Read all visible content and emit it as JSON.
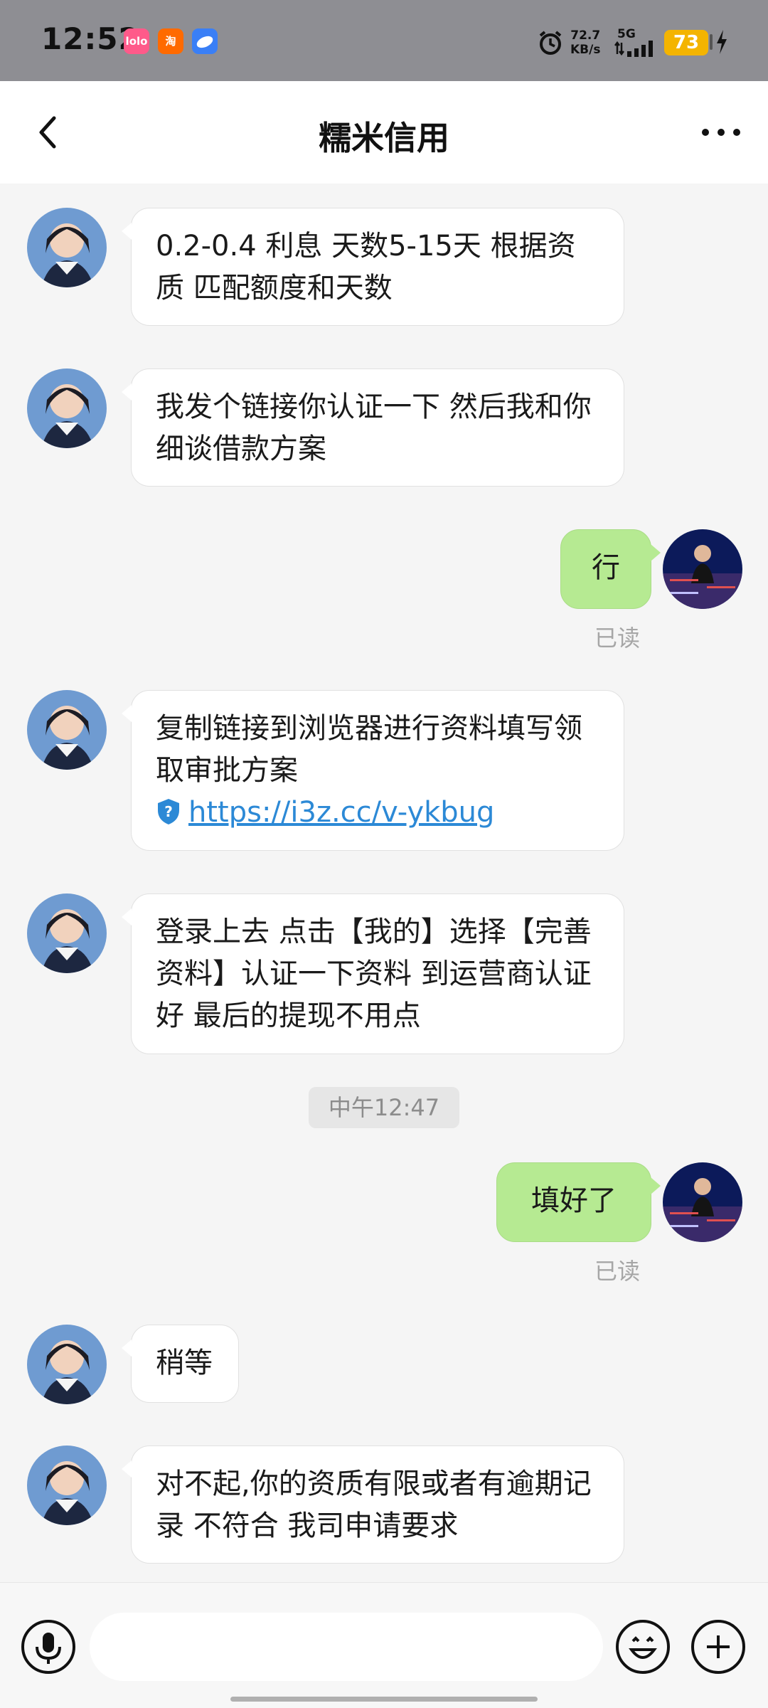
{
  "status_bar": {
    "time": "12:52",
    "network_speed_value": "72.7",
    "network_speed_unit": "KB/s",
    "network_type": "5G",
    "battery": "73",
    "app_icons": [
      "lolo-app-icon",
      "taobao-app-icon",
      "cloud-app-icon"
    ]
  },
  "header": {
    "title": "糯米信用"
  },
  "messages": [
    {
      "side": "left",
      "text": "0.2-0.4 利息 天数5-15天  根据资质 匹配额度和天数"
    },
    {
      "side": "left",
      "text": "我发个链接你认证一下 然后我和你细谈借款方案"
    },
    {
      "side": "right",
      "text": "行",
      "status": "已读"
    },
    {
      "side": "left",
      "text": "复制链接到浏览器进行资料填写领取审批方案",
      "link": "https://i3z.cc/v-ykbug"
    },
    {
      "side": "left",
      "text": "登录上去 点击【我的】选择【完善资料】认证一下资料 到运营商认证好 最后的提现不用点"
    },
    {
      "side": "right",
      "text": "填好了",
      "status": "已读"
    },
    {
      "side": "left",
      "text": "稍等"
    },
    {
      "side": "left",
      "text": "对不起,你的资质有限或者有逾期记录  不符合 我司申请要求"
    }
  ],
  "timestamp": "中午12:47",
  "input": {
    "placeholder": "",
    "value": ""
  },
  "colors": {
    "status_bar_bg": "#8e8e93",
    "right_bubble": "#b6ea92",
    "link": "#2c89d6",
    "battery": "#f4b400"
  }
}
